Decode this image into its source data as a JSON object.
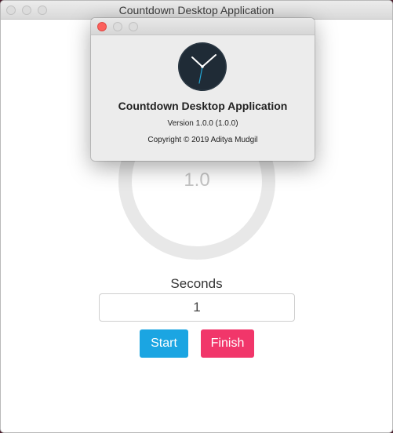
{
  "window": {
    "title": "Countdown Desktop Application"
  },
  "timer": {
    "display_value": "1.0"
  },
  "form": {
    "seconds_label": "Seconds",
    "seconds_value": "1",
    "start_label": "Start",
    "finish_label": "Finish"
  },
  "about_dialog": {
    "icon": "clock-icon",
    "app_name": "Countdown Desktop Application",
    "version": "Version 1.0.0 (1.0.0)",
    "copyright": "Copyright © 2019 Aditya Mudgil"
  },
  "colors": {
    "start_button": "#1ba5e2",
    "finish_button": "#f1366a",
    "ring": "#e8e8e8",
    "close_button": "#fc605c"
  }
}
